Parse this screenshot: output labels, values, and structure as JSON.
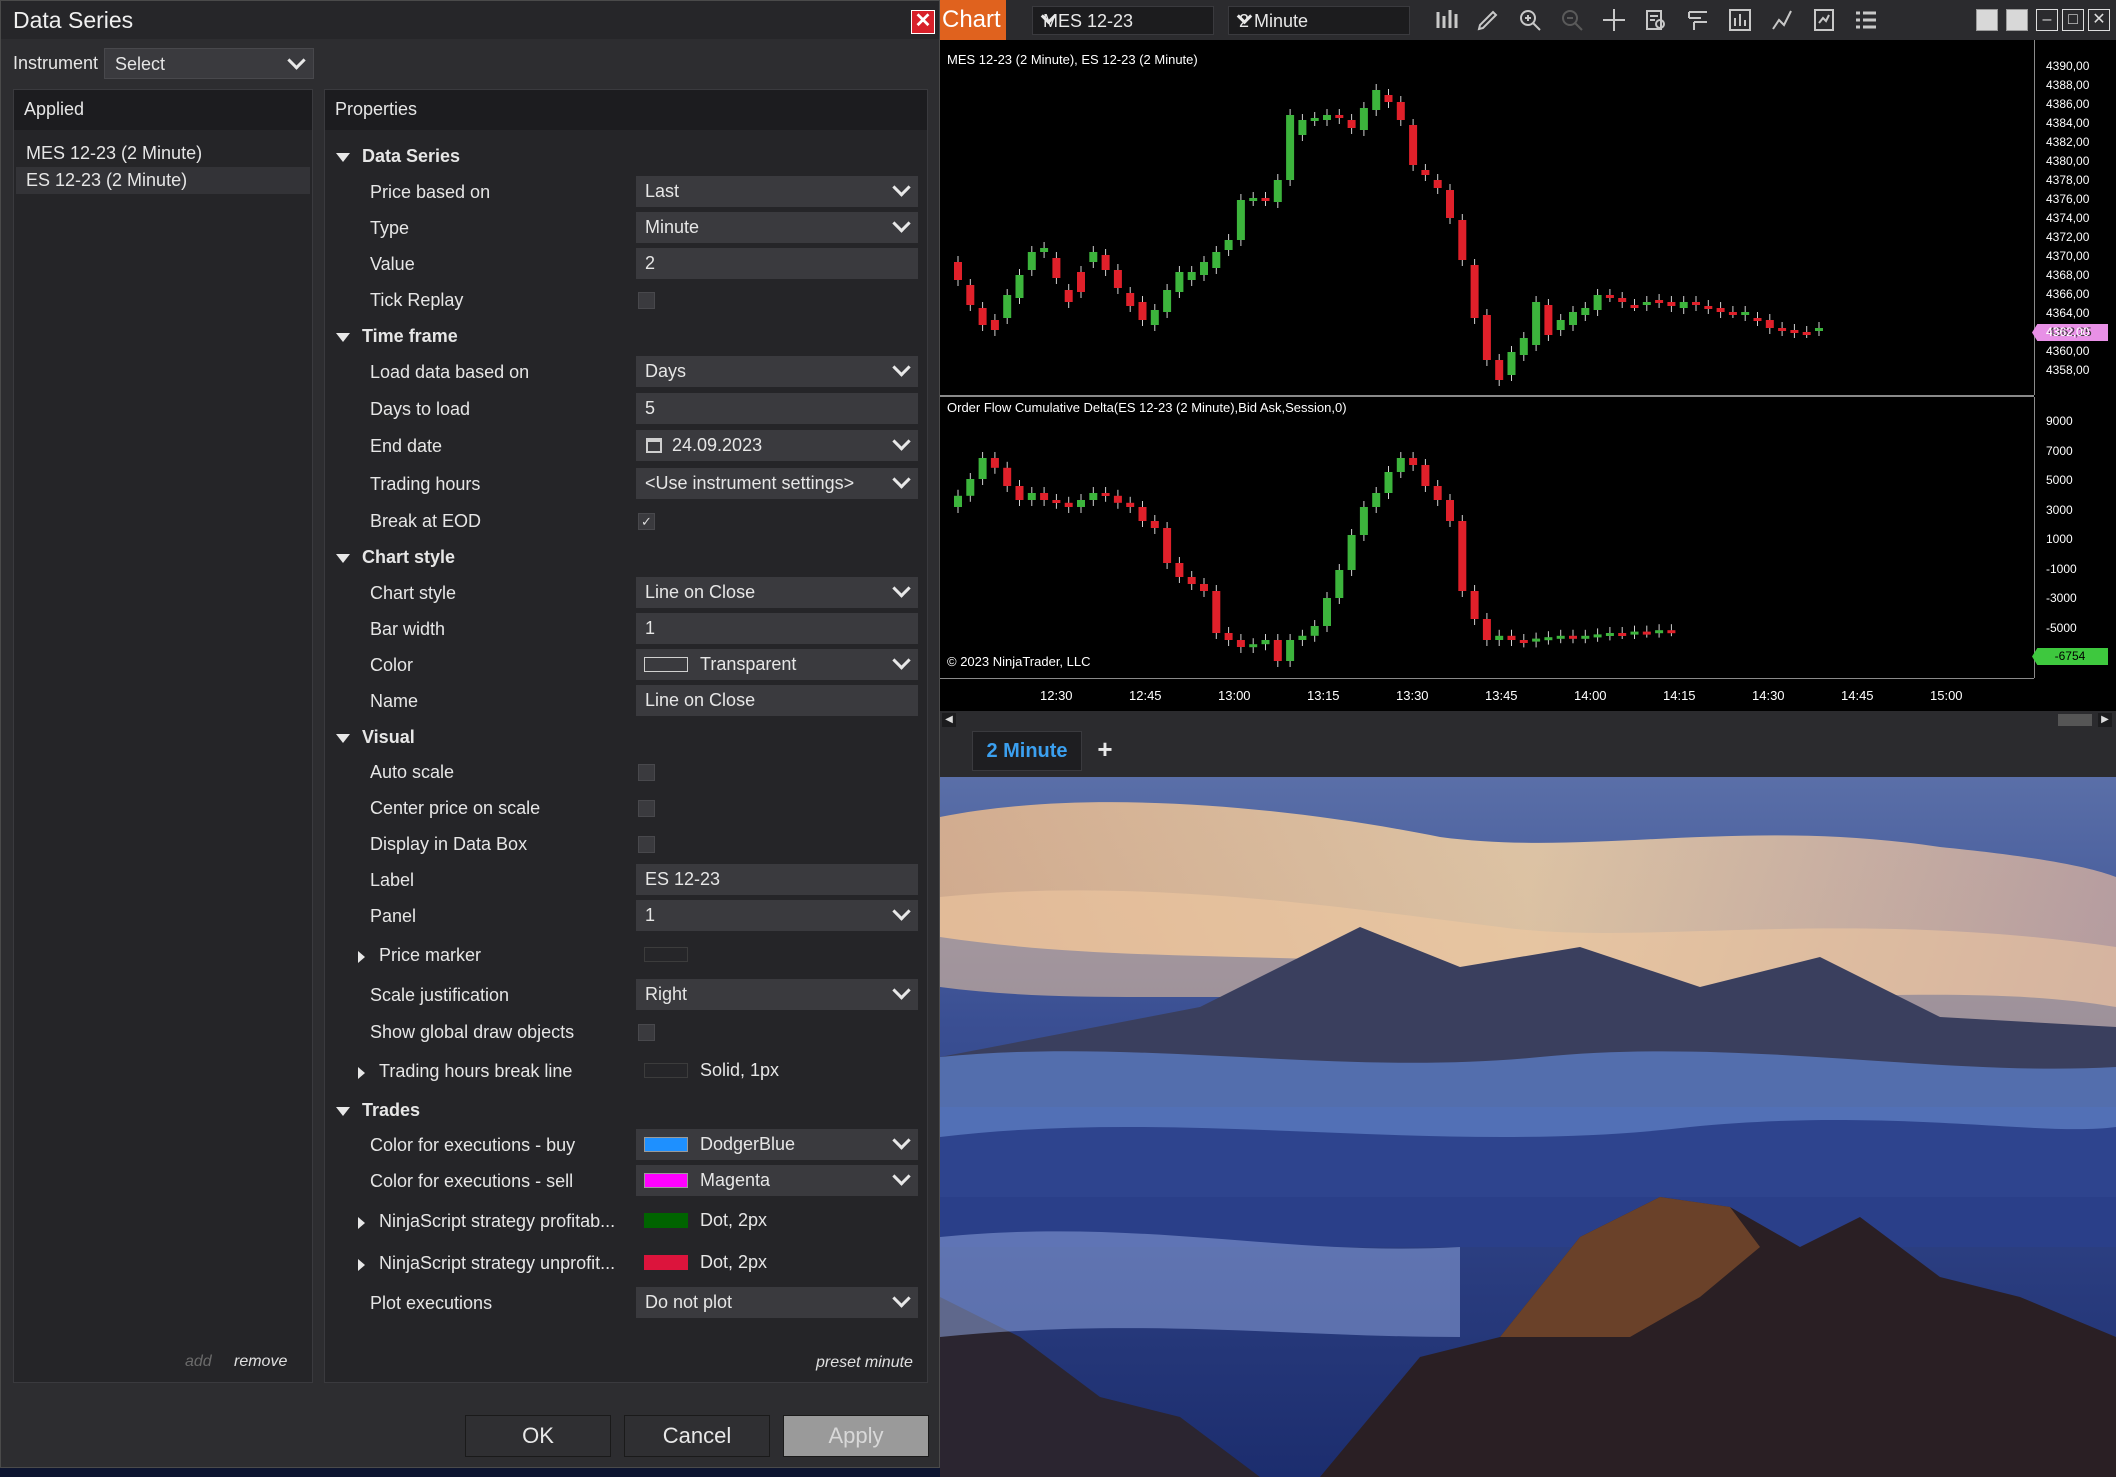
{
  "dialog": {
    "title": "Data Series",
    "instrument_label": "Instrument",
    "instrument_value": "Select",
    "applied_header": "Applied",
    "applied_items": [
      "MES 12-23 (2 Minute)",
      "ES 12-23 (2 Minute)"
    ],
    "add_label": "add",
    "remove_label": "remove",
    "properties_header": "Properties",
    "preset_label": "preset minute",
    "ok_label": "OK",
    "cancel_label": "Cancel",
    "apply_label": "Apply",
    "sections": {
      "data_series": "Data Series",
      "time_frame": "Time frame",
      "chart_style": "Chart style",
      "visual": "Visual",
      "trades": "Trades"
    },
    "props": {
      "price_based_on": {
        "label": "Price based on",
        "value": "Last"
      },
      "type": {
        "label": "Type",
        "value": "Minute"
      },
      "value": {
        "label": "Value",
        "value": "2"
      },
      "tick_replay": {
        "label": "Tick Replay",
        "checked": false
      },
      "load_data_based_on": {
        "label": "Load data based on",
        "value": "Days"
      },
      "days_to_load": {
        "label": "Days to load",
        "value": "5"
      },
      "end_date": {
        "label": "End date",
        "value": "24.09.2023"
      },
      "trading_hours": {
        "label": "Trading hours",
        "value": "<Use instrument settings>"
      },
      "break_at_eod": {
        "label": "Break at EOD",
        "checked": true,
        "mark": "✓"
      },
      "chart_style": {
        "label": "Chart style",
        "value": "Line on Close"
      },
      "bar_width": {
        "label": "Bar width",
        "value": "1"
      },
      "color": {
        "label": "Color",
        "value": "Transparent",
        "swatch": "transparent"
      },
      "name": {
        "label": "Name",
        "value": "Line on Close"
      },
      "auto_scale": {
        "label": "Auto scale",
        "checked": false
      },
      "center_price": {
        "label": "Center price on scale",
        "checked": false
      },
      "display_data_box": {
        "label": "Display in Data Box",
        "checked": false
      },
      "label": {
        "label": "Label",
        "value": "ES 12-23"
      },
      "panel": {
        "label": "Panel",
        "value": "1"
      },
      "price_marker": {
        "label": "Price marker"
      },
      "scale_justification": {
        "label": "Scale justification",
        "value": "Right"
      },
      "show_global_draw": {
        "label": "Show global draw objects",
        "checked": false
      },
      "trading_hours_break_line": {
        "label": "Trading hours break line",
        "value": "Solid, 1px"
      },
      "exec_buy": {
        "label": "Color for executions - buy",
        "value": "DodgerBlue",
        "swatch": "#1e90ff"
      },
      "exec_sell": {
        "label": "Color for executions - sell",
        "value": "Magenta",
        "swatch": "#ff00ff"
      },
      "strategy_profit": {
        "label": "NinjaScript strategy profitab...",
        "value": "Dot, 2px",
        "swatch": "#006400"
      },
      "strategy_unprofit": {
        "label": "NinjaScript strategy unprofit...",
        "value": "Dot, 2px",
        "swatch": "#dc143c"
      },
      "plot_executions": {
        "label": "Plot executions",
        "value": "Do not plot"
      }
    }
  },
  "chart": {
    "tab_label": "Chart",
    "instrument": "MES 12-23",
    "interval": "2 Minute",
    "upper_title": "MES 12-23 (2 Minute), ES 12-23 (2 Minute)",
    "lower_title": "Order Flow Cumulative Delta(ES 12-23 (2 Minute),Bid Ask,Session,0)",
    "copyright": "© 2023 NinjaTrader, LLC",
    "price_ticks": [
      "4390,00",
      "4388,00",
      "4386,00",
      "4384,00",
      "4382,00",
      "4380,00",
      "4378,00",
      "4376,00",
      "4374,00",
      "4372,00",
      "4370,00",
      "4368,00",
      "4366,00",
      "4364,00",
      "4362,00",
      "4360,00",
      "4358,00"
    ],
    "last_price": "4362,25",
    "delta_ticks": [
      "9000",
      "7000",
      "5000",
      "3000",
      "1000",
      "-1000",
      "-3000",
      "-5000"
    ],
    "last_delta": "-6754",
    "time_ticks": [
      "12:30",
      "12:45",
      "13:00",
      "13:15",
      "13:30",
      "13:45",
      "14:00",
      "14:15",
      "14:30",
      "14:45",
      "15:00"
    ],
    "timeframe_tab": "2 Minute",
    "add_tab": "+",
    "colors": {
      "up": "#3cb43c",
      "down": "#e0202a",
      "tab_accent": "#e0621e",
      "tf_tab": "#3ba0f0"
    }
  },
  "icons": {
    "close": "✕",
    "calendar": "calendar-icon",
    "toolbar": [
      "bars-icon",
      "pencil-icon",
      "zoom-in-icon",
      "zoom-out-icon",
      "crosshair-icon",
      "data-box-icon",
      "drawing-objects-icon",
      "indicators-icon",
      "strategies-icon",
      "templates-icon",
      "properties-icon"
    ]
  }
}
